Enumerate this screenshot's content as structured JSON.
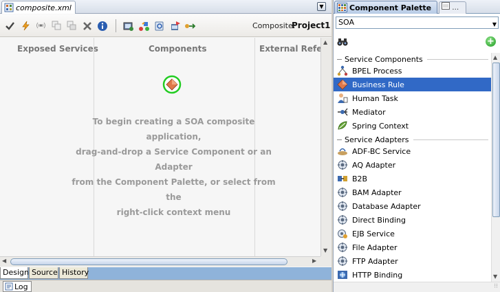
{
  "editor": {
    "tab_label": "composite.xml",
    "toolbar": {
      "composite_label": "Composite:",
      "composite_name": "Project1"
    },
    "lanes": {
      "exposed_services": "Exposed Services",
      "components": "Components",
      "external_references": "External Refere"
    },
    "hint_lines": [
      "To begin creating a SOA composite application,",
      "drag-and-drop a Service Component or an Adapter",
      "from the Component Palette, or select from the",
      "right-click context menu"
    ],
    "bottom_tabs": [
      "Design",
      "Source",
      "History"
    ],
    "active_bottom_tab": "Design",
    "log_tab": "Log"
  },
  "palette": {
    "title": "Component Palette",
    "selected_category": "SOA",
    "sections": [
      {
        "title": "Service Components",
        "items": [
          "BPEL Process",
          "Business Rule",
          "Human Task",
          "Mediator",
          "Spring Context"
        ]
      },
      {
        "title": "Service Adapters",
        "items": [
          "ADF-BC Service",
          "AQ Adapter",
          "B2B",
          "BAM Adapter",
          "Database Adapter",
          "Direct Binding",
          "EJB Service",
          "File Adapter",
          "FTP Adapter",
          "HTTP Binding"
        ]
      }
    ],
    "selected_item": "Business Rule"
  },
  "colors": {
    "selection": "#3169c6",
    "hint_text": "#9a9a9a",
    "ring": "#22cc22",
    "rule_diamond": "#e0784a"
  }
}
